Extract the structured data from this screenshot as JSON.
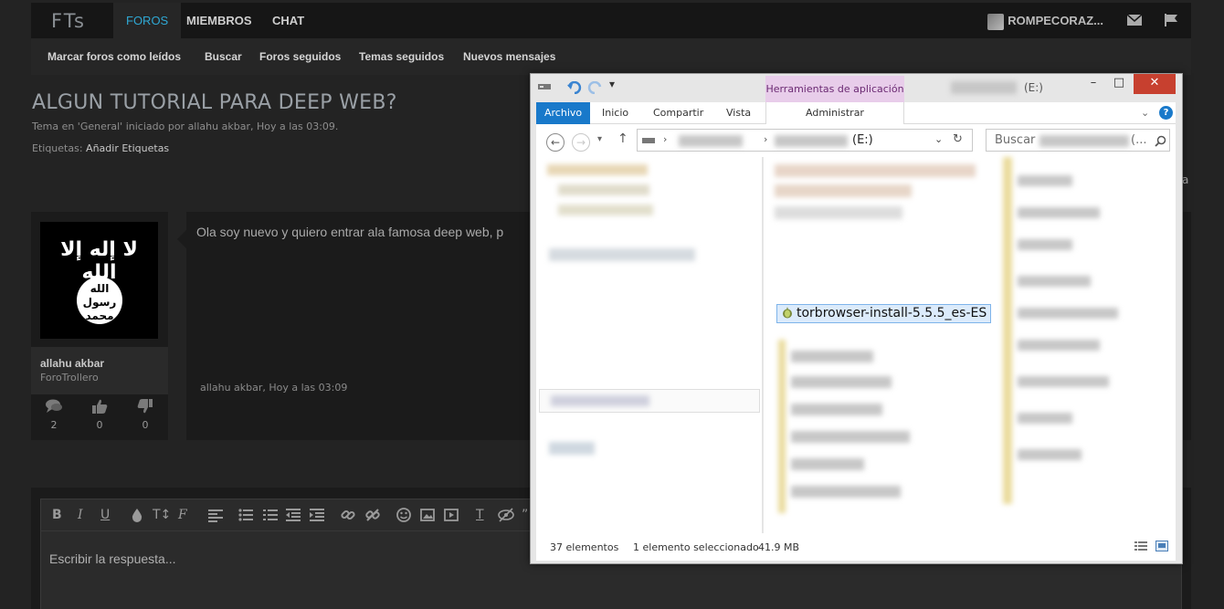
{
  "forum": {
    "logo": "FTs",
    "nav": {
      "foros": "FOROS",
      "miembros": "MIEMBROS",
      "chat": "CHAT"
    },
    "username": "ROMPECORAZ...",
    "subnav": [
      "Marcar foros como leídos",
      "Buscar",
      "Foros seguidos",
      "Temas seguidos",
      "Nuevos mensajes"
    ],
    "thread": {
      "title": "ALGUN TUTORIAL PARA DEEP WEB?",
      "meta": "Tema en 'General' iniciado por allahu akbar, Hoy a las 03:09.",
      "tags_label": "Etiquetas:",
      "tags_link": "Añadir Etiquetas"
    },
    "post": {
      "author": "allahu akbar",
      "role": "ForoTrollero",
      "stats": {
        "messages": "2",
        "likes": "0",
        "dislikes": "0"
      },
      "text": "Ola soy nuevo y quiero entrar ala famosa deep web, p",
      "footer": "allahu akbar, Hoy a las 03:09",
      "avatar_text_top": "لا إله إلا الله",
      "avatar_seal": "الله\nرسول\nمحمد"
    },
    "stray_letter": "a",
    "editor": {
      "placeholder": "Escribir la respuesta..."
    }
  },
  "explorer": {
    "context_tab": "Herramientas de aplicación",
    "caption_drive": "(E:)",
    "ribbon_tabs": [
      "Archivo",
      "Inicio",
      "Compartir",
      "Vista"
    ],
    "admin_tab": "Administrar",
    "address_drive": "(E:)",
    "search_placeholder": "Buscar",
    "search_suffix": "(...",
    "selected_file": "torbrowser-install-5.5.5_es-ES",
    "status": {
      "count": "37 elementos",
      "selected": "1 elemento seleccionado",
      "size": "41.9 MB"
    }
  }
}
